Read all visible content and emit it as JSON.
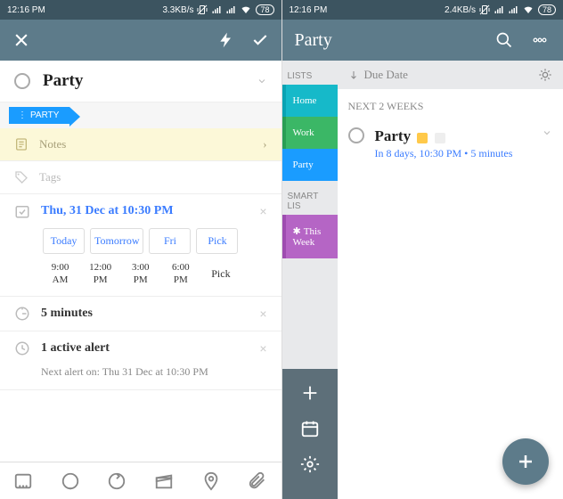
{
  "left": {
    "status": {
      "time": "12:16 PM",
      "net": "3.3KB/s",
      "batt": "78"
    },
    "title": "Party",
    "tab": "PARTY",
    "notes": "Notes",
    "tags": "Tags",
    "due": "Thu, 31 Dec at 10:30 PM",
    "quick": {
      "today": "Today",
      "tomorrow": "Tomorrow",
      "fri": "Fri",
      "pick": "Pick"
    },
    "times": {
      "t1a": "9:00",
      "t1b": "AM",
      "t2a": "12:00",
      "t2b": "PM",
      "t3a": "3:00",
      "t3b": "PM",
      "t4a": "6:00",
      "t4b": "PM",
      "pick": "Pick"
    },
    "duration": "5 minutes",
    "alert_title": "1 active alert",
    "alert_sub": "Next alert on: Thu 31 Dec at 10:30 PM"
  },
  "right": {
    "status": {
      "time": "12:16 PM",
      "net": "2.4KB/s",
      "batt": "78"
    },
    "header": "Party",
    "sort": "Due Date",
    "sidebar": {
      "heading1": "LISTS",
      "home": "Home",
      "work": "Work",
      "party": "Party",
      "heading2": "SMART LIS",
      "week": "This Week"
    },
    "group": "NEXT 2 WEEKS",
    "item": {
      "title": "Party",
      "sub": "In 8 days, 10:30 PM • 5 minutes"
    }
  }
}
